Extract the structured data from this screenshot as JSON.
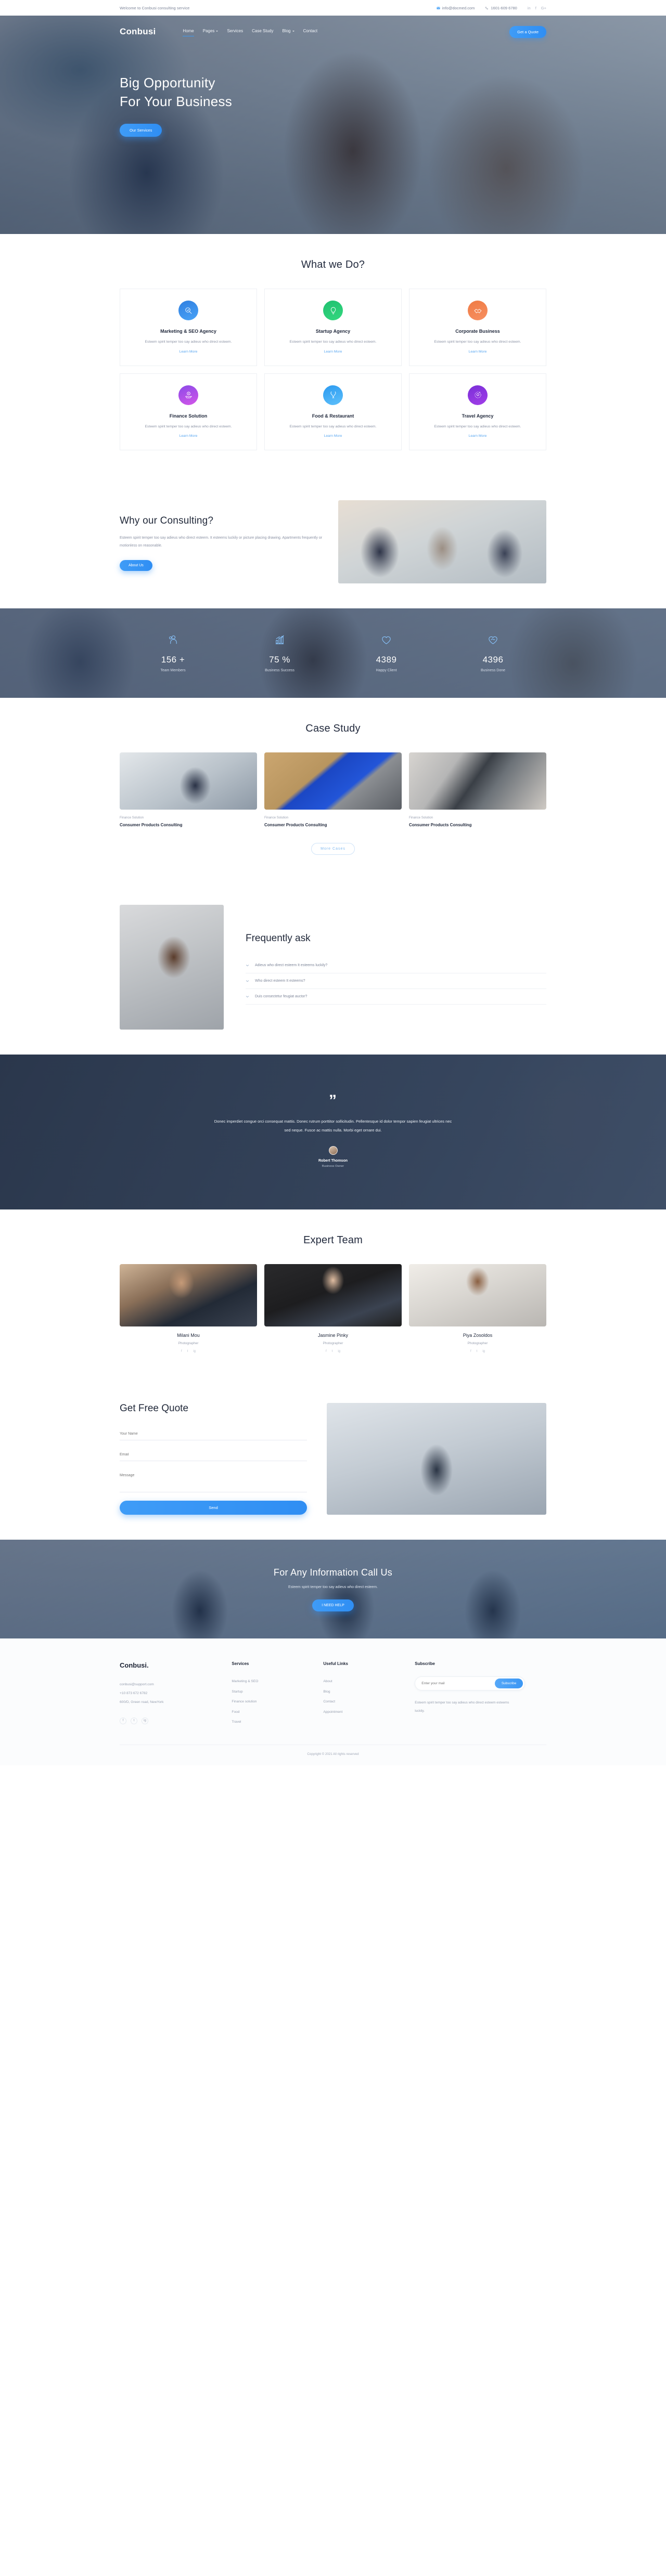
{
  "topbar": {
    "welcome": "Welcome to Conbusi consulting service",
    "email": "info@docmed.com",
    "phone": "1601-609 6780",
    "social": [
      "in",
      "f",
      "G+"
    ]
  },
  "nav": {
    "brand": "Conbusi",
    "links": [
      {
        "label": "Home",
        "caret": false,
        "active": true
      },
      {
        "label": "Pages",
        "caret": true,
        "active": false
      },
      {
        "label": "Services",
        "caret": false,
        "active": false
      },
      {
        "label": "Case Study",
        "caret": false,
        "active": false
      },
      {
        "label": "Blog",
        "caret": true,
        "active": false
      },
      {
        "label": "Contact",
        "caret": false,
        "active": false
      }
    ],
    "quote_button": "Get a Quote"
  },
  "hero": {
    "title_line1": "Big Opportunity",
    "title_line2": "For Your Business",
    "button": "Our Services"
  },
  "services": {
    "title": "What we Do?",
    "learn_more": "Learn More",
    "cards": [
      {
        "name": "Marketing & SEO Agency",
        "desc": "Esteem spirit temper too say adieus who direct esteem.",
        "icon": "magnifier-target-icon",
        "color1": "#2f7fe0",
        "color2": "#4aa3f7"
      },
      {
        "name": "Startup Agency",
        "desc": "Esteem spirit temper too say adieus who direct esteem.",
        "icon": "lightbulb-icon",
        "color1": "#20c070",
        "color2": "#34d87f"
      },
      {
        "name": "Corporate Business",
        "desc": "Esteem spirit temper too say adieus who direct esteem.",
        "icon": "handshake-icon",
        "color1": "#ef7b44",
        "color2": "#f79062"
      },
      {
        "name": "Finance Solution",
        "desc": "Esteem spirit temper too say adieus who direct esteem.",
        "icon": "hand-money-icon",
        "color1": "#8b4ae8",
        "color2": "#d456e8"
      },
      {
        "name": "Food & Restaurant",
        "desc": "Esteem spirit temper too say adieus who direct esteem.",
        "icon": "fork-spoon-icon",
        "color1": "#2b9af0",
        "color2": "#5ec0fb"
      },
      {
        "name": "Travel Agency",
        "desc": "Esteem spirit temper too say adieus who direct esteem.",
        "icon": "globe-pin-icon",
        "color1": "#7a2fd8",
        "color2": "#a23ee8"
      }
    ]
  },
  "why": {
    "title": "Why our Consulting?",
    "text": "Esteem spirit temper too say adieus who direct esteem. It esteems luckily or picture placing drawing. Apartments frequently or motionless on reasonable.",
    "button": "About Us"
  },
  "counters": [
    {
      "value": "156 +",
      "label": "Team Members",
      "icon": "people-icon"
    },
    {
      "value": "75 %",
      "label": "Business Success",
      "icon": "growth-chart-icon"
    },
    {
      "value": "4389",
      "label": "Happy Client",
      "icon": "heart-icon"
    },
    {
      "value": "4396",
      "label": "Business Done",
      "icon": "heart-handshake-icon"
    }
  ],
  "case_study": {
    "title": "Case Study",
    "more_button": "More Cases",
    "items": [
      {
        "category": "Finance Solution",
        "title": "Consumer Products Consulting"
      },
      {
        "category": "Finance Solution",
        "title": "Consumer Products Consulting"
      },
      {
        "category": "Finance Solution",
        "title": "Consumer Products Consulting"
      }
    ]
  },
  "faq": {
    "title": "Frequently ask",
    "items": [
      "Adieus who direct esteem It esteems luckily?",
      "Who direct esteem It esteems?",
      "Duis consectetur feugiat auctor?"
    ]
  },
  "testimonial": {
    "quote_mark": "”",
    "text": "Donec imperdiet congue orci consequat mattis. Donec rutrum porttitor sollicitudin. Pellentesque id dolor tempor sapien feugiat ultrices nec sed neque. Fusce ac mattis nulla. Morbi eget ornare dui.",
    "author": "Robert Thomson",
    "role": "Business Owner"
  },
  "team": {
    "title": "Expert Team",
    "members": [
      {
        "name": "Milani Mou",
        "role": "Photographer"
      },
      {
        "name": "Jasmine Pinky",
        "role": "Photographer"
      },
      {
        "name": "Piya Zosoldos",
        "role": "Photographer"
      }
    ]
  },
  "quote_form": {
    "title": "Get Free Quote",
    "name_placeholder": "Your Name",
    "email_placeholder": "Email",
    "message_placeholder": "Message",
    "submit": "Send"
  },
  "cta": {
    "title": "For Any Information Call Us",
    "subtitle": "Esteem spirit temper too say adieus who direct esteem.",
    "button": "I NEED HELP"
  },
  "footer": {
    "brand": "Conbusi.",
    "email": "conbusi@support.com",
    "phone": "+10 873 672 6782",
    "address": "600/D, Green road, NewYork",
    "social": [
      "f",
      "t",
      "ig"
    ],
    "services_title": "Services",
    "services": [
      "Marketing & SEO",
      "Startup",
      "Finance solution",
      "Food",
      "Travel"
    ],
    "links_title": "Useful Links",
    "links": [
      "About",
      "Blog",
      "Contact",
      "Appointment"
    ],
    "subscribe_title": "Subscribe",
    "subscribe_placeholder": "Enter your mail",
    "subscribe_button": "Subscribe",
    "subscribe_note": "Esteem spirit temper too say adieus who direct esteem esteems luckily.",
    "copyright": "Copyright © 2021 All rights reserved"
  }
}
